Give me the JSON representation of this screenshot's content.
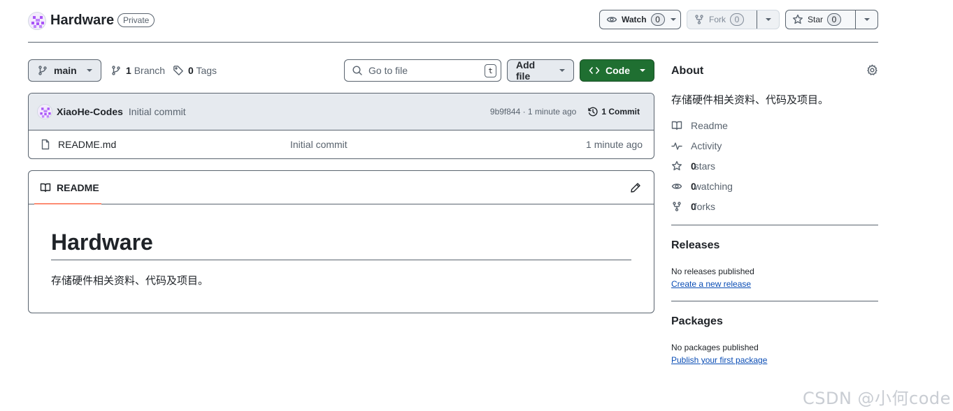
{
  "repo": {
    "name": "Hardware",
    "visibility": "Private"
  },
  "header_actions": {
    "watch_label": "Watch",
    "watch_count": "0",
    "fork_label": "Fork",
    "fork_count": "0",
    "star_label": "Star",
    "star_count": "0"
  },
  "toolbar": {
    "branch": "main",
    "branch_count": "1",
    "branch_label": "Branch",
    "tag_count": "0",
    "tag_label": "Tags",
    "search_placeholder": "Go to file",
    "search_shortcut": "t",
    "add_file_label": "Add file",
    "code_label": "Code"
  },
  "commit": {
    "author": "XiaoHe-Codes",
    "message": "Initial commit",
    "hash_time": "9b9f844 · 1 minute ago",
    "count_label": "1 Commit"
  },
  "files": [
    {
      "name": "README.md",
      "commit_message": "Initial commit",
      "time": "1 minute ago"
    }
  ],
  "readme": {
    "tab_label": "README",
    "heading": "Hardware",
    "body": "存储硬件相关资料、代码及项目。"
  },
  "about": {
    "title": "About",
    "description": "存储硬件相关资料、代码及项目。",
    "readme_label": "Readme",
    "activity_label": "Activity",
    "stars_count": "0",
    "stars_label": "stars",
    "watching_count": "0",
    "watching_label": "watching",
    "forks_count": "0",
    "forks_label": "forks"
  },
  "releases": {
    "title": "Releases",
    "empty_text": "No releases published",
    "create_link": "Create a new release"
  },
  "packages": {
    "title": "Packages",
    "empty_text": "No packages published",
    "publish_link": "Publish your first package"
  },
  "watermark": "CSDN @小何code",
  "colors": {
    "code_button": "#1f6f31",
    "link": "#0a4db5",
    "tab_underline": "#fd8c73"
  }
}
